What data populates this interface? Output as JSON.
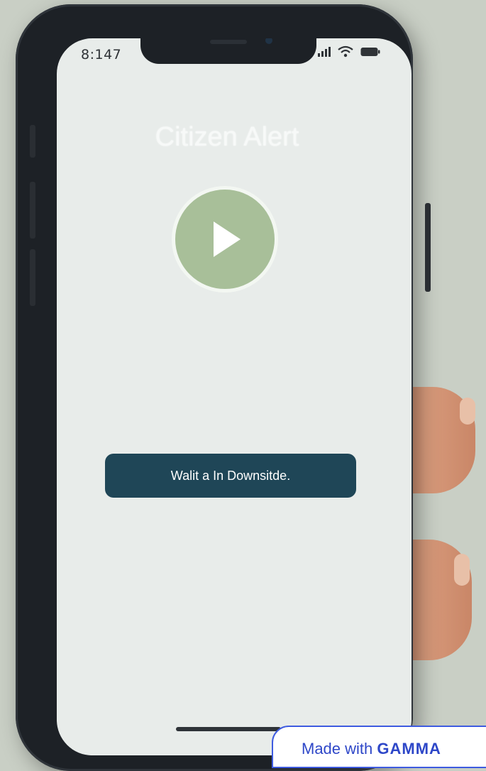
{
  "status_bar": {
    "time": "8:147",
    "signal_icon": "signal-icon",
    "wifi_icon": "wifi-icon",
    "battery_icon": "battery-icon"
  },
  "app": {
    "title": "Citizen Alert",
    "play_icon": "play-icon",
    "message": "Walit a In Downsitde."
  },
  "badge": {
    "text": "Made with",
    "brand": "GAMMA"
  },
  "colors": {
    "background": "#c9cfc5",
    "screen": "#e8ecea",
    "play_circle": "#a8bf99",
    "message_bar": "#1f4657",
    "badge_accent": "#2e47c8"
  }
}
